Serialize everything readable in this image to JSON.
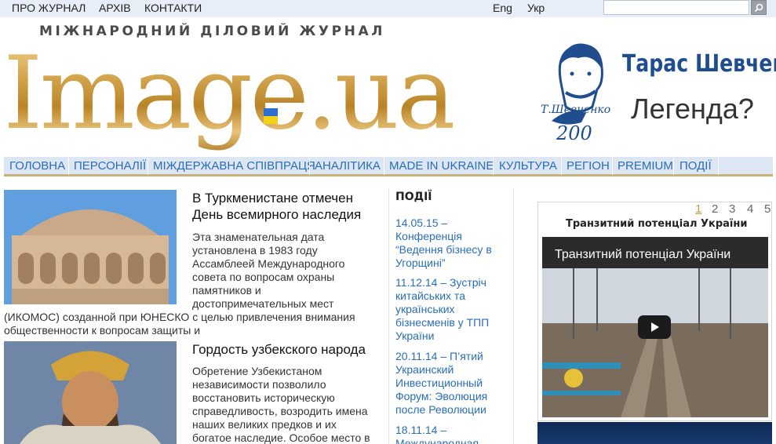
{
  "top_nav": {
    "items": [
      "ПРО ЖУРНАЛ",
      "АРХІВ",
      "КОНТАКТИ"
    ],
    "lang_en": "Eng",
    "lang_ua": "Укр",
    "search_placeholder": ""
  },
  "logo": {
    "subtitle": "МІЖНАРОДНИЙ ДІЛОВИЙ ЖУРНАЛ",
    "main": "Image",
    "dot": ".",
    "suffix": "ua"
  },
  "banner": {
    "name": "Тарас Шевченко",
    "tagline": "Легенда?",
    "signature": "Т.Шевченко",
    "anniversary": "200"
  },
  "main_nav": {
    "items": [
      "ГОЛОВНА",
      "ПЕРСОНАЛІЇ",
      "МІЖДЕРЖАВНА СПІВПРАЦЯ",
      "АНАЛІТИКА",
      "MADE IN UKRAINE",
      "КУЛЬТУРА",
      "РЕГІОН",
      "PREMIUM",
      "ПОДІЇ"
    ]
  },
  "articles": [
    {
      "title_lines": [
        "В Туркменистане отмечен",
        "День всемирного наследия"
      ],
      "lines": [
        "Эта знаменательная дата",
        "установлена в 1983 году",
        "Ассамблеей Международного",
        "совета по вопросам охраны",
        "памятников и",
        "достопримечательных мест",
        "(ИКОМОС) созданной при ЮНЕСКО с целью привлечения внимания",
        "общественности к вопросам защиты и"
      ]
    },
    {
      "title_lines": [
        "Гордость узбекского народа"
      ],
      "lines": [
        "Обретение Узбекистаном",
        "независимости позволило",
        "восстановить историческую",
        "справедливость, возродить имена",
        "наших великих предков и их",
        "богатое наследие. Особое место в"
      ]
    }
  ],
  "events": {
    "heading": "ПОДІЇ",
    "items": [
      [
        "14.05.15 –",
        "Конференція",
        "“Ведення бізнесу в",
        "Угорщині”"
      ],
      [
        "11.12.14 – Зустріч",
        "китайських та",
        "українських",
        "бізнесменів у ТПП",
        "України"
      ],
      [
        "20.11.14 – П’ятий",
        "Украинский",
        "Инвестиционный",
        "Форум: Эволюция",
        "после Революции"
      ],
      [
        "18.11.14 –",
        "Международная"
      ]
    ]
  },
  "widget": {
    "pages": [
      "1",
      "2",
      "3",
      "4",
      "5"
    ],
    "active_page": "1",
    "title": "Транзитний потенціал України",
    "video_title": "Транзитний потенціал України"
  },
  "colors": {
    "link": "#2a6db5",
    "nav_bg": "#dde6f3",
    "gold": "#c09a4e",
    "banner_blue": "#1f4d8e"
  }
}
